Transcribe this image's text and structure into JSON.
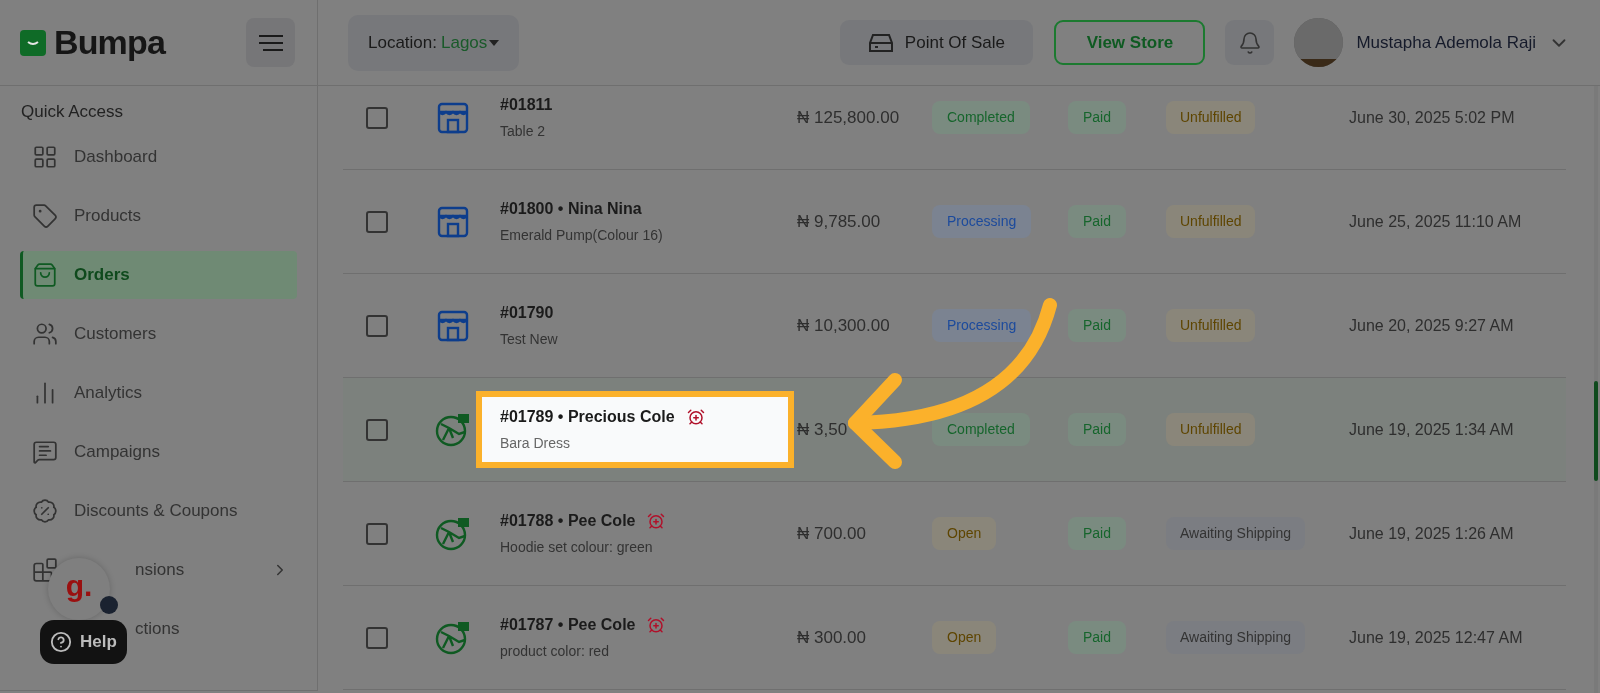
{
  "brand": "Bumpa",
  "header": {
    "location_label": "Location:",
    "location_value": "Lagos",
    "pos_button": "Point Of Sale",
    "view_store_button": "View Store",
    "user_name": "Mustapha Ademola Raji"
  },
  "sidebar": {
    "section_title": "Quick Access",
    "items": [
      {
        "label": "Dashboard",
        "selected": false,
        "has_submenu": false
      },
      {
        "label": "Products",
        "selected": false,
        "has_submenu": false
      },
      {
        "label": "Orders",
        "selected": true,
        "has_submenu": false
      },
      {
        "label": "Customers",
        "selected": false,
        "has_submenu": false
      },
      {
        "label": "Analytics",
        "selected": false,
        "has_submenu": false
      },
      {
        "label": "Campaigns",
        "selected": false,
        "has_submenu": false
      },
      {
        "label": "Discounts & Coupons",
        "selected": false,
        "has_submenu": false
      },
      {
        "label": "nsions",
        "selected": false,
        "has_submenu": true
      },
      {
        "label": "ctions",
        "selected": false,
        "has_submenu": false
      }
    ]
  },
  "help_widget": {
    "avatar_letter": "g.",
    "label": "Help"
  },
  "orders": [
    {
      "kind": "store",
      "title": "#01811",
      "subtitle": "Table 2",
      "reminder": false,
      "amount": "₦ 125,800.00",
      "status": "Completed",
      "payment": "Paid",
      "fulfillment": "Unfulfilled",
      "date": "June 30, 2025 5:02 PM",
      "highlighted": false,
      "checked": false
    },
    {
      "kind": "store",
      "title": "#01800 • Nina Nina",
      "subtitle": "Emerald Pump(Colour 16)",
      "reminder": false,
      "amount": "₦ 9,785.00",
      "status": "Processing",
      "payment": "Paid",
      "fulfillment": "Unfulfilled",
      "date": "June 25, 2025 11:10 AM",
      "highlighted": false,
      "checked": false
    },
    {
      "kind": "store",
      "title": "#01790",
      "subtitle": "Test New",
      "reminder": false,
      "amount": "₦ 10,300.00",
      "status": "Processing",
      "payment": "Paid",
      "fulfillment": "Unfulfilled",
      "date": "June 20, 2025 9:27 AM",
      "highlighted": false,
      "checked": false
    },
    {
      "kind": "web",
      "title": "#01789 • Precious Cole",
      "subtitle": "Bara Dress",
      "reminder": true,
      "amount": "₦ 3,50",
      "status": "Completed",
      "payment": "Paid",
      "fulfillment": "Unfulfilled",
      "date": "June 19, 2025 1:34 AM",
      "highlighted": true,
      "checked": false
    },
    {
      "kind": "web",
      "title": "#01788 • Pee Cole",
      "subtitle": "Hoodie set colour: green",
      "reminder": true,
      "amount": "₦ 700.00",
      "status": "Open",
      "payment": "Paid",
      "fulfillment": "Awaiting Shipping",
      "date": "June 19, 2025 1:26 AM",
      "highlighted": false,
      "checked": false
    },
    {
      "kind": "web",
      "title": "#01787 • Pee Cole",
      "subtitle": "product color: red",
      "reminder": true,
      "amount": "₦ 300.00",
      "status": "Open",
      "payment": "Paid",
      "fulfillment": "Awaiting Shipping",
      "date": "June 19, 2025 12:47 AM",
      "highlighted": false,
      "checked": false
    }
  ]
}
